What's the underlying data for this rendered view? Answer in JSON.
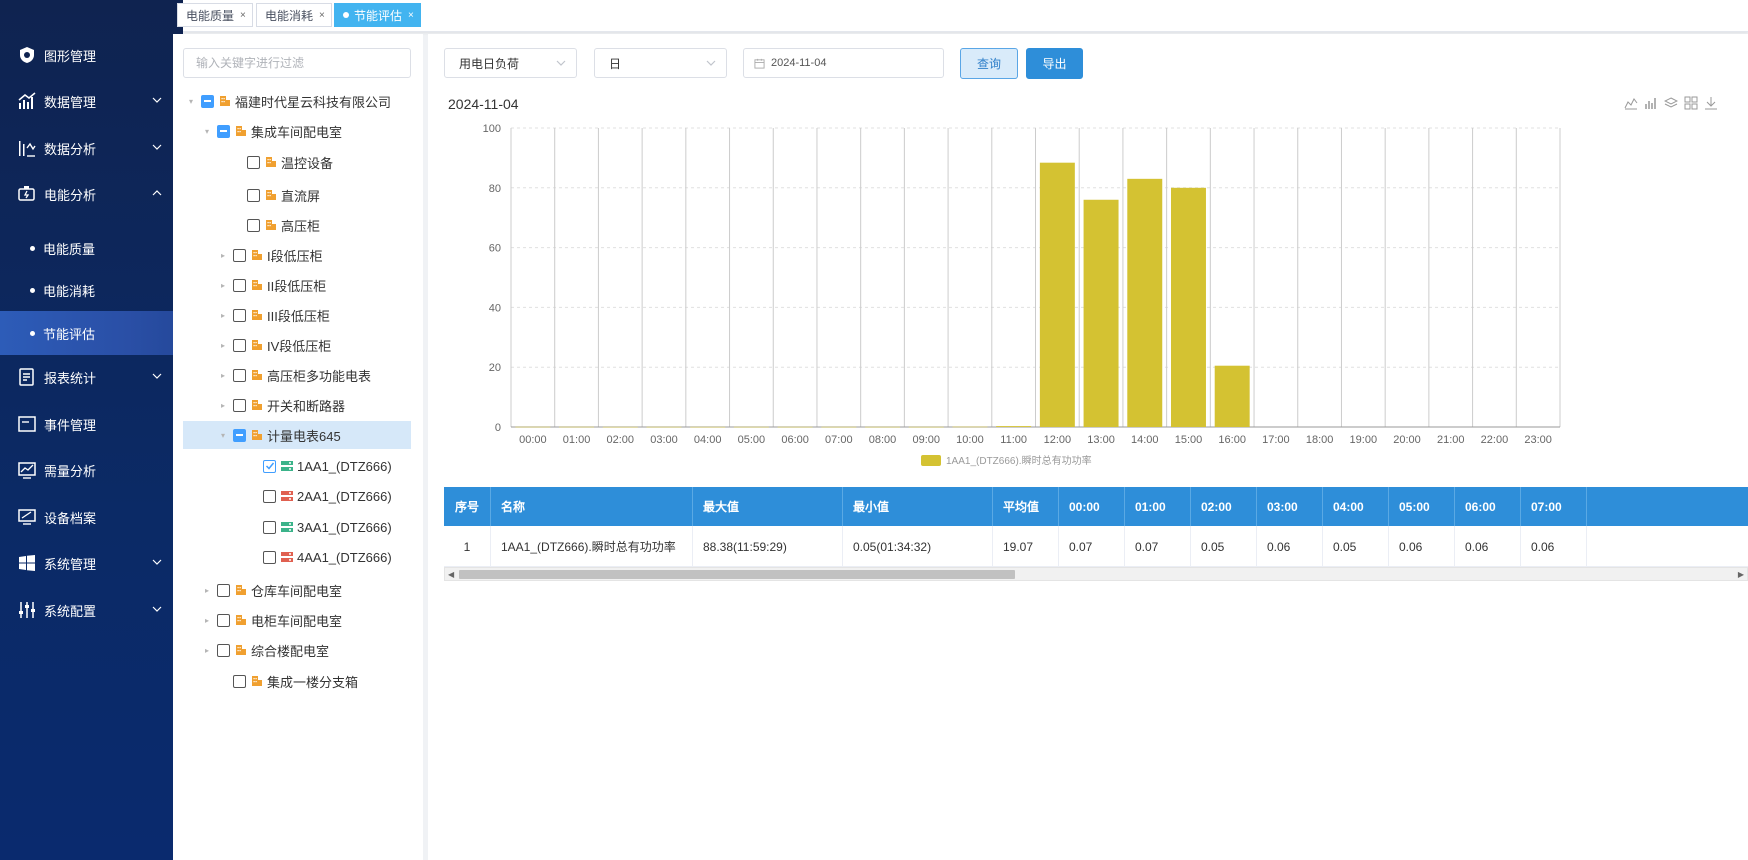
{
  "tabs": [
    {
      "label": "电能质量",
      "close": "×"
    },
    {
      "label": "电能消耗",
      "close": "×"
    },
    {
      "label": "节能评估",
      "close": "×"
    }
  ],
  "sidebar": {
    "items": [
      {
        "label": "图形管理",
        "icon": "shield-icon"
      },
      {
        "label": "数据管理",
        "icon": "bar-trend-icon"
      },
      {
        "label": "数据分析",
        "icon": "analysis-icon"
      },
      {
        "label": "电能分析",
        "icon": "battery-icon"
      },
      {
        "label": "报表统计",
        "icon": "report-icon"
      },
      {
        "label": "事件管理",
        "icon": "event-icon"
      },
      {
        "label": "需量分析",
        "icon": "monitor-chart-icon"
      },
      {
        "label": "设备档案",
        "icon": "device-icon"
      },
      {
        "label": "系统管理",
        "icon": "windows-icon"
      },
      {
        "label": "系统配置",
        "icon": "sliders-icon"
      }
    ],
    "sub_items": [
      {
        "label": "电能质量"
      },
      {
        "label": "电能消耗"
      },
      {
        "label": "节能评估"
      }
    ]
  },
  "tree": {
    "filter_placeholder": "输入关键字进行过滤",
    "nodes": [
      {
        "label": "福建时代星云科技有限公司"
      },
      {
        "label": "集成车间配电室"
      },
      {
        "label": "温控设备"
      },
      {
        "label": "直流屏"
      },
      {
        "label": "高压柜"
      },
      {
        "label": "I段低压柜"
      },
      {
        "label": "II段低压柜"
      },
      {
        "label": "III段低压柜"
      },
      {
        "label": "IV段低压柜"
      },
      {
        "label": "高压柜多功能电表"
      },
      {
        "label": "开关和断路器"
      },
      {
        "label": "计量电表645"
      },
      {
        "label": "1AA1_(DTZ666)"
      },
      {
        "label": "2AA1_(DTZ666)"
      },
      {
        "label": "3AA1_(DTZ666)"
      },
      {
        "label": "4AA1_(DTZ666)"
      },
      {
        "label": "仓库车间配电室"
      },
      {
        "label": "电柜车间配电室"
      },
      {
        "label": "综合楼配电室"
      },
      {
        "label": "集成一楼分支箱"
      }
    ]
  },
  "toolbar": {
    "type_select": "用电日负荷",
    "period_select": "日",
    "date_value": "2024-11-04",
    "query_label": "查询",
    "export_label": "导出"
  },
  "chart_title": "2024-11-04",
  "colors": {
    "bar": "#d4c232",
    "header": "#2e8ed9",
    "accent": "#409eff"
  },
  "chart_data": {
    "type": "bar",
    "categories": [
      "00:00",
      "01:00",
      "02:00",
      "03:00",
      "04:00",
      "05:00",
      "06:00",
      "07:00",
      "08:00",
      "09:00",
      "10:00",
      "11:00",
      "12:00",
      "13:00",
      "14:00",
      "15:00",
      "16:00",
      "17:00",
      "18:00",
      "19:00",
      "20:00",
      "21:00",
      "22:00",
      "23:00"
    ],
    "series": [
      {
        "name": "1AA1_(DTZ666).瞬时总有功功率",
        "values": [
          0.07,
          0.07,
          0.05,
          0.06,
          0.05,
          0.06,
          0.06,
          0.06,
          0.06,
          0.06,
          0.1,
          0.3,
          88.4,
          76,
          83,
          80,
          20.5,
          0,
          0,
          0,
          0,
          0,
          0,
          0
        ]
      }
    ],
    "ylim": [
      0,
      100
    ],
    "yticks": [
      "0",
      "20",
      "40",
      "60",
      "80",
      "100"
    ],
    "grid": true,
    "legend": "bottom"
  },
  "table": {
    "headers": [
      "序号",
      "名称",
      "最大值",
      "最小值",
      "平均值",
      "00:00",
      "01:00",
      "02:00",
      "03:00",
      "04:00",
      "05:00",
      "06:00",
      "07:00"
    ],
    "rows": [
      [
        "1",
        "1AA1_(DTZ666).瞬时总有功功率",
        "88.38(11:59:29)",
        "0.05(01:34:32)",
        "19.07",
        "0.07",
        "0.07",
        "0.05",
        "0.06",
        "0.05",
        "0.06",
        "0.06",
        "0.06"
      ]
    ]
  }
}
